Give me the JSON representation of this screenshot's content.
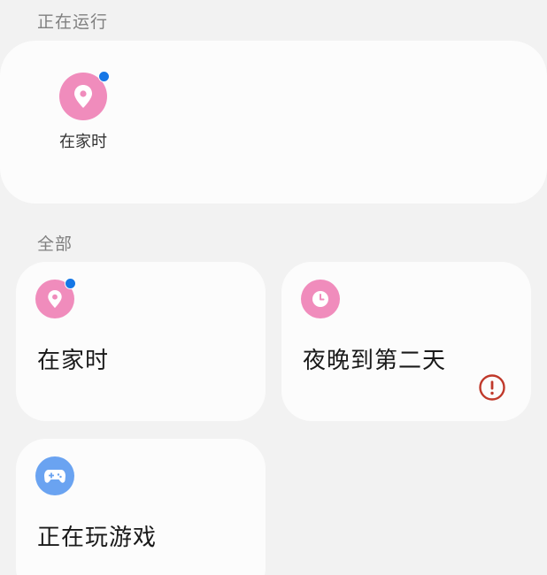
{
  "sections": {
    "running": {
      "title": "正在运行"
    },
    "all": {
      "title": "全部"
    }
  },
  "running_modes": [
    {
      "label": "在家时",
      "icon": "location-icon",
      "active": true
    }
  ],
  "modes": [
    {
      "label": "在家时",
      "icon": "location-icon",
      "active": true
    },
    {
      "label": "夜晚到第二天",
      "icon": "clock-icon",
      "warning": true
    },
    {
      "label": "正在玩游戏",
      "icon": "gamepad-icon"
    }
  ],
  "colors": {
    "pink": "#f08cbc",
    "blue_icon": "#6aa3f1",
    "active_dot": "#1677e6",
    "warning": "#c0392b"
  }
}
